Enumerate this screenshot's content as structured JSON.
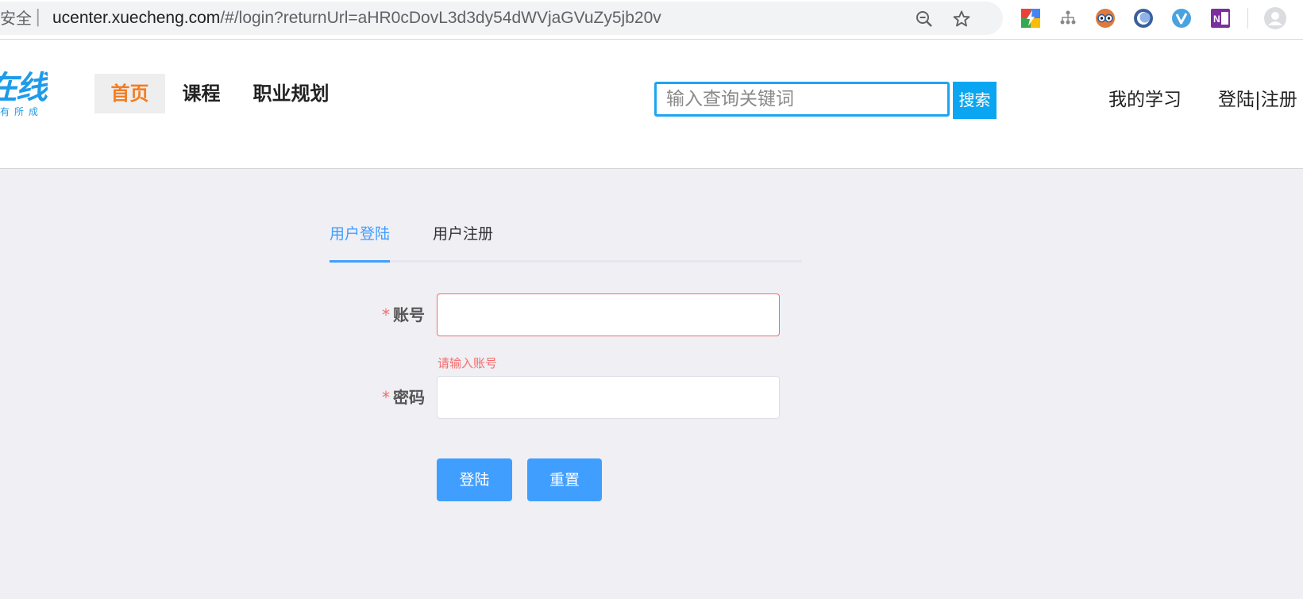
{
  "browser": {
    "security_label": "安全",
    "separator": "|",
    "url_host": "ucenter.xuecheng.com",
    "url_path": "/#/login?returnUrl=aHR0cDovL3d3dy54dWVjaGVuZy5jb20v",
    "icons": [
      "zoom-out-icon",
      "bookmark-star-icon"
    ],
    "extensions": [
      "colorful-lightning-extension-icon",
      "sitemap-extension-icon",
      "owl-extension-icon",
      "circle-extension-icon",
      "v-extension-icon",
      "onenote-extension-icon",
      "profile-avatar-icon"
    ]
  },
  "header": {
    "logo_main": "在线",
    "logo_sub": "有所成",
    "nav": [
      {
        "label": "首页",
        "active": true
      },
      {
        "label": "课程",
        "active": false
      },
      {
        "label": "职业规划",
        "active": false
      }
    ],
    "search_placeholder": "输入查询关键词",
    "search_button": "搜索",
    "my_learning": "我的学习",
    "login_register": "登陆|注册"
  },
  "login": {
    "tabs": [
      {
        "label": "用户登陆",
        "active": true
      },
      {
        "label": "用户注册",
        "active": false
      }
    ],
    "required_mark": "*",
    "account_label": "账号",
    "account_value": "",
    "account_error": "请输入账号",
    "password_label": "密码",
    "password_value": "",
    "login_button": "登陆",
    "reset_button": "重置"
  },
  "colors": {
    "brand_blue": "#1e9bea",
    "nav_active": "#f47c20",
    "primary": "#409eff",
    "error": "#f56c6c",
    "page_bg": "#efeff4"
  }
}
